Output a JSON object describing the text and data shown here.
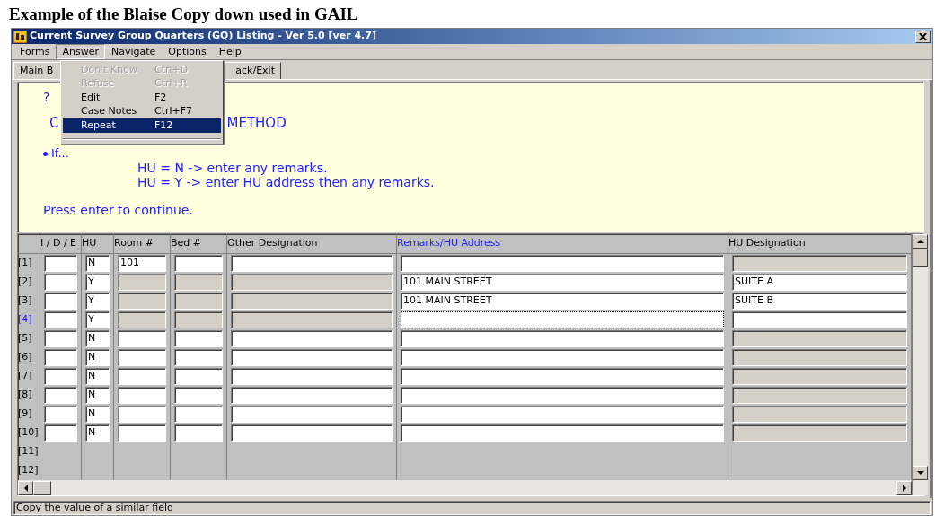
{
  "caption": "Example of the Blaise Copy down used in GAIL",
  "window": {
    "title": "Current Survey Group Quarters (GQ) Listing - Ver 5.0 [ver 4.7]"
  },
  "menu_bar": [
    {
      "label": "Forms",
      "selected": false
    },
    {
      "label": "Answer",
      "selected": true
    },
    {
      "label": "Navigate",
      "selected": false
    },
    {
      "label": "Options",
      "selected": false
    },
    {
      "label": "Help",
      "selected": false
    }
  ],
  "menu": [
    {
      "label": "Don't Know",
      "shortcut": "Ctrl+D",
      "disabled": true,
      "selected": false
    },
    {
      "label": "Refuse",
      "shortcut": "Ctrl+R",
      "disabled": true,
      "selected": false
    },
    {
      "label": "Edit",
      "shortcut": "F2",
      "disabled": false,
      "selected": false
    },
    {
      "label": "Case Notes",
      "shortcut": "Ctrl+F7",
      "disabled": false,
      "selected": false
    },
    {
      "label": "Repeat",
      "shortcut": "F12",
      "disabled": false,
      "selected": true
    }
  ],
  "tabs": [
    "Main B",
    "ack/Exit"
  ],
  "question": {
    "mark": "?",
    "heading_start": "C",
    "heading_end": "METHOD",
    "bullet": "If...",
    "lines": [
      "HU = N -> enter any remarks.",
      "HU = Y -> enter HU address then any remarks."
    ],
    "prompt": "Press enter to continue."
  },
  "columns": [
    {
      "label": "I / D / E",
      "selected": false
    },
    {
      "label": "HU",
      "selected": false
    },
    {
      "label": "Room #",
      "selected": false
    },
    {
      "label": "Bed #",
      "selected": false
    },
    {
      "label": "Other Designation",
      "selected": false
    },
    {
      "label": "Remarks/HU Address",
      "selected": true
    },
    {
      "label": "HU Designation",
      "selected": false
    }
  ],
  "rows": [
    {
      "label": "[1]",
      "selected": false,
      "cells": [
        {
          "disabled": false
        },
        {
          "value": "N",
          "disabled": false
        },
        {
          "value": "101",
          "disabled": false
        },
        {
          "disabled": false
        },
        {
          "disabled": false
        },
        {
          "disabled": false
        },
        {
          "disabled": true
        }
      ]
    },
    {
      "label": "[2]",
      "selected": false,
      "cells": [
        {
          "disabled": false
        },
        {
          "value": "Y",
          "disabled": false
        },
        {
          "disabled": true
        },
        {
          "disabled": true
        },
        {
          "disabled": true
        },
        {
          "value": "101 MAIN STREET",
          "disabled": false
        },
        {
          "value": "SUITE A",
          "disabled": false
        }
      ]
    },
    {
      "label": "[3]",
      "selected": false,
      "cells": [
        {
          "disabled": false
        },
        {
          "value": "Y",
          "disabled": false
        },
        {
          "disabled": true
        },
        {
          "disabled": true
        },
        {
          "disabled": true
        },
        {
          "value": "101 MAIN STREET",
          "disabled": false
        },
        {
          "value": "SUITE B",
          "disabled": false
        }
      ]
    },
    {
      "label": "[4]",
      "selected": true,
      "cells": [
        {
          "disabled": false
        },
        {
          "value": "Y",
          "disabled": false
        },
        {
          "disabled": true
        },
        {
          "disabled": true
        },
        {
          "disabled": true
        },
        {
          "disabled": false
        },
        {
          "disabled": false
        }
      ]
    },
    {
      "label": "[5]",
      "selected": false,
      "cells": [
        {
          "disabled": false
        },
        {
          "value": "N",
          "disabled": false
        },
        {
          "disabled": false
        },
        {
          "disabled": false
        },
        {
          "disabled": false
        },
        {
          "disabled": false
        },
        {
          "disabled": true
        }
      ]
    },
    {
      "label": "[6]",
      "selected": false,
      "cells": [
        {
          "disabled": false
        },
        {
          "value": "N",
          "disabled": false
        },
        {
          "disabled": false
        },
        {
          "disabled": false
        },
        {
          "disabled": false
        },
        {
          "disabled": false
        },
        {
          "disabled": true
        }
      ]
    },
    {
      "label": "[7]",
      "selected": false,
      "cells": [
        {
          "disabled": false
        },
        {
          "value": "N",
          "disabled": false
        },
        {
          "disabled": false
        },
        {
          "disabled": false
        },
        {
          "disabled": false
        },
        {
          "disabled": false
        },
        {
          "disabled": true
        }
      ]
    },
    {
      "label": "[8]",
      "selected": false,
      "cells": [
        {
          "disabled": false
        },
        {
          "value": "N",
          "disabled": false
        },
        {
          "disabled": false
        },
        {
          "disabled": false
        },
        {
          "disabled": false
        },
        {
          "disabled": false
        },
        {
          "disabled": true
        }
      ]
    },
    {
      "label": "[9]",
      "selected": false,
      "cells": [
        {
          "disabled": false
        },
        {
          "value": "N",
          "disabled": false
        },
        {
          "disabled": false
        },
        {
          "disabled": false
        },
        {
          "disabled": false
        },
        {
          "disabled": false
        },
        {
          "disabled": true
        }
      ]
    },
    {
      "label": "[10]",
      "selected": false,
      "cells": [
        {
          "disabled": false
        },
        {
          "value": "N",
          "disabled": false
        },
        {
          "disabled": false
        },
        {
          "disabled": false
        },
        {
          "disabled": false
        },
        {
          "disabled": false
        },
        {
          "disabled": true
        }
      ]
    },
    {
      "label": "[11]",
      "selected": false
    },
    {
      "label": "[12]",
      "selected": false
    }
  ],
  "status_bar": "Copy the value of a similar field"
}
